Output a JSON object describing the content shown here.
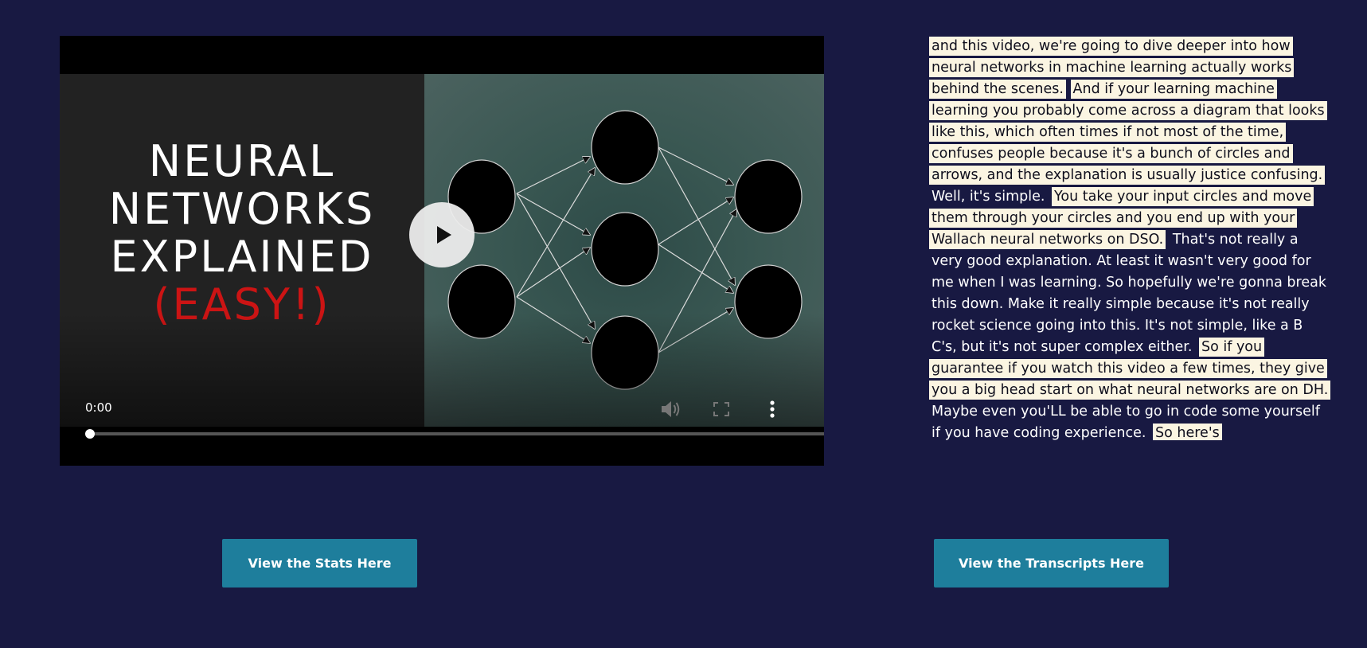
{
  "video": {
    "thumbnail_lines": [
      "NEURAL",
      "NETWORKS",
      "EXPLAINED",
      "(EASY!)"
    ],
    "current_time": "0:00",
    "progress": 0,
    "icons": {
      "play": "play-icon",
      "volume": "volume-icon",
      "fullscreen": "fullscreen-icon",
      "more": "more-vertical-icon"
    }
  },
  "transcript": {
    "segments": [
      {
        "text": "and this video, we're going to dive deeper into how neural networks in machine learning actually works behind the scenes.",
        "highlighted": true
      },
      {
        "text": "And if your learning machine learning you probably come across a diagram that looks like this, which often times if not most of the time, confuses people because it's a bunch of circles and arrows, and the explanation is usually justice confusing.",
        "highlighted": true
      },
      {
        "text": "Well, it's simple.",
        "highlighted": false
      },
      {
        "text": "You take your input circles and move them through your circles and you end up with your Wallach neural networks on DSO.",
        "highlighted": true
      },
      {
        "text": "That's not really a very good explanation. At least it wasn't very good for me when I was learning. So hopefully we're gonna break this down. Make it really simple because it's not really rocket science going into this. It's not simple, like a B C's, but it's not super complex either.",
        "highlighted": false
      },
      {
        "text": "So if you guarantee if you watch this video a few times, they give you a big head start on what neural networks are on DH.",
        "highlighted": true
      },
      {
        "text": "Maybe even you'LL be able to go in code some yourself if you have coding experience.",
        "highlighted": false
      },
      {
        "text": "So here's",
        "highlighted": true
      }
    ]
  },
  "buttons": {
    "stats_label": "View the Stats Here",
    "transcripts_label": "View the Transcripts Here"
  },
  "colors": {
    "background": "#181942",
    "button": "#1e7e9c",
    "highlight": "#fbf5e2",
    "thumbnail_accent": "#cc1414"
  }
}
